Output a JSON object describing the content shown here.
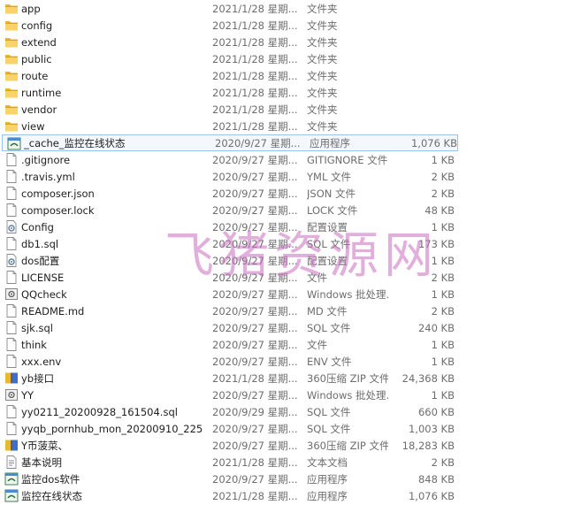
{
  "files": [
    {
      "name": "app",
      "date": "2021/1/28 星期...",
      "type": "文件夹",
      "size": "",
      "icon": "folder-icon"
    },
    {
      "name": "config",
      "date": "2021/1/28 星期...",
      "type": "文件夹",
      "size": "",
      "icon": "folder-icon"
    },
    {
      "name": "extend",
      "date": "2021/1/28 星期...",
      "type": "文件夹",
      "size": "",
      "icon": "folder-icon"
    },
    {
      "name": "public",
      "date": "2021/1/28 星期...",
      "type": "文件夹",
      "size": "",
      "icon": "folder-icon"
    },
    {
      "name": "route",
      "date": "2021/1/28 星期...",
      "type": "文件夹",
      "size": "",
      "icon": "folder-icon"
    },
    {
      "name": "runtime",
      "date": "2021/1/28 星期...",
      "type": "文件夹",
      "size": "",
      "icon": "folder-icon"
    },
    {
      "name": "vendor",
      "date": "2021/1/28 星期...",
      "type": "文件夹",
      "size": "",
      "icon": "folder-icon"
    },
    {
      "name": "view",
      "date": "2021/1/28 星期...",
      "type": "文件夹",
      "size": "",
      "icon": "folder-icon"
    },
    {
      "name": "_cache_监控在线状态",
      "date": "2020/9/27 星期...",
      "type": "应用程序",
      "size": "1,076 KB",
      "icon": "application-icon",
      "selected": true
    },
    {
      "name": ".gitignore",
      "date": "2020/9/27 星期...",
      "type": "GITIGNORE 文件",
      "size": "1 KB",
      "icon": "file-icon"
    },
    {
      "name": ".travis.yml",
      "date": "2020/9/27 星期...",
      "type": "YML 文件",
      "size": "2 KB",
      "icon": "file-icon"
    },
    {
      "name": "composer.json",
      "date": "2020/9/27 星期...",
      "type": "JSON 文件",
      "size": "2 KB",
      "icon": "file-icon"
    },
    {
      "name": "composer.lock",
      "date": "2020/9/27 星期...",
      "type": "LOCK 文件",
      "size": "48 KB",
      "icon": "file-icon"
    },
    {
      "name": "Config",
      "date": "2020/9/27 星期...",
      "type": "配置设置",
      "size": "1 KB",
      "icon": "config-settings-icon"
    },
    {
      "name": "db1.sql",
      "date": "2020/9/27 星期...",
      "type": "SQL 文件",
      "size": "173 KB",
      "icon": "file-icon"
    },
    {
      "name": "dos配置",
      "date": "2020/9/27 星期...",
      "type": "配置设置",
      "size": "1 KB",
      "icon": "config-settings-icon"
    },
    {
      "name": "LICENSE",
      "date": "2020/9/27 星期...",
      "type": "文件",
      "size": "2 KB",
      "icon": "file-icon"
    },
    {
      "name": "QQcheck",
      "date": "2020/9/27 星期...",
      "type": "Windows 批处理...",
      "size": "1 KB",
      "icon": "batch-file-icon"
    },
    {
      "name": "README.md",
      "date": "2020/9/27 星期...",
      "type": "MD 文件",
      "size": "2 KB",
      "icon": "file-icon"
    },
    {
      "name": "sjk.sql",
      "date": "2020/9/27 星期...",
      "type": "SQL 文件",
      "size": "240 KB",
      "icon": "file-icon"
    },
    {
      "name": "think",
      "date": "2020/9/27 星期...",
      "type": "文件",
      "size": "1 KB",
      "icon": "file-icon"
    },
    {
      "name": "xxx.env",
      "date": "2020/9/27 星期...",
      "type": "ENV 文件",
      "size": "1 KB",
      "icon": "file-icon"
    },
    {
      "name": "yb接口",
      "date": "2021/1/28 星期...",
      "type": "360压缩 ZIP 文件",
      "size": "24,368 KB",
      "icon": "zip-archive-icon"
    },
    {
      "name": "YY",
      "date": "2020/9/27 星期...",
      "type": "Windows 批处理...",
      "size": "1 KB",
      "icon": "batch-file-icon"
    },
    {
      "name": "yy0211_20200928_161504.sql",
      "date": "2020/9/29 星期...",
      "type": "SQL 文件",
      "size": "660 KB",
      "icon": "file-icon"
    },
    {
      "name": "yyqb_pornhub_mon_20200910_22565...",
      "date": "2020/9/27 星期...",
      "type": "SQL 文件",
      "size": "1,003 KB",
      "icon": "file-icon"
    },
    {
      "name": "Y币菠菜、",
      "date": "2020/9/27 星期...",
      "type": "360压缩 ZIP 文件",
      "size": "18,283 KB",
      "icon": "zip-archive-icon"
    },
    {
      "name": "基本说明",
      "date": "2021/1/28 星期...",
      "type": "文本文档",
      "size": "2 KB",
      "icon": "text-document-icon"
    },
    {
      "name": "监控dos软件",
      "date": "2020/9/27 星期...",
      "type": "应用程序",
      "size": "848 KB",
      "icon": "application-icon"
    },
    {
      "name": "监控在线状态",
      "date": "2021/1/28 星期...",
      "type": "应用程序",
      "size": "1,076 KB",
      "icon": "application-icon"
    }
  ],
  "watermark": "飞猪资源网"
}
